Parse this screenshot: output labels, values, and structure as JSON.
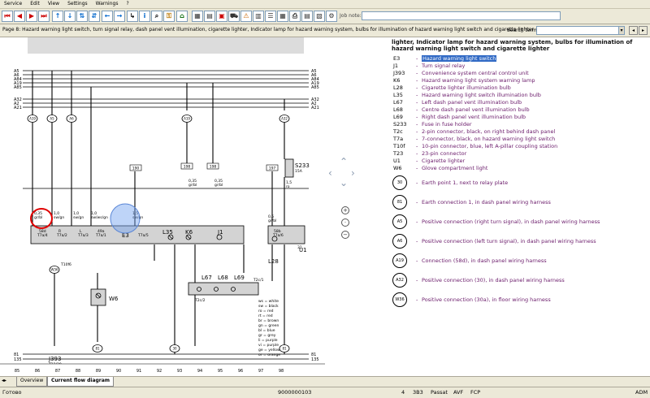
{
  "menu": [
    "Service",
    "Edit",
    "View",
    "Settings",
    "Warnings",
    "?"
  ],
  "toolbar": {
    "job_note_label": "Job note:"
  },
  "page": {
    "title": "Page 8: Hazard warning light switch, turn signal relay, dash panel vent illumination, cigarette lighter, Indicator lamp for hazard warning system, bulbs for illumination of hazard warning light switch and cigarette lighter"
  },
  "search": {
    "label": "Search term:",
    "value": ""
  },
  "legend": {
    "heading": "lighter, Indicator lamp for hazard warning system, bulbs for illumination of hazard warning light switch and cigarette lighter",
    "items": [
      {
        "code": "E3",
        "desc": "Hazard warning light switch",
        "selected": true
      },
      {
        "code": "J1",
        "desc": "Turn signal relay"
      },
      {
        "code": "J393",
        "desc": "Convenience system central control unit"
      },
      {
        "code": "K6",
        "desc": "Hazard warning light system warning lamp"
      },
      {
        "code": "L28",
        "desc": "Cigarette lighter illumination bulb"
      },
      {
        "code": "L35",
        "desc": "Hazard warning light switch illumination bulb"
      },
      {
        "code": "L67",
        "desc": "Left dash panel vent illumination bulb"
      },
      {
        "code": "L68",
        "desc": "Centre dash panel vent illumination bulb"
      },
      {
        "code": "L69",
        "desc": "Right dash panel vent illumination bulb"
      },
      {
        "code": "S233",
        "desc": "Fuse in fuse holder"
      },
      {
        "code": "T2c",
        "desc": "2-pin connector, black, on right behind dash panel"
      },
      {
        "code": "T7a",
        "desc": "7-connector, black, on hazard warning light switch"
      },
      {
        "code": "T10f",
        "desc": "10-pin connector, blue, left A-pillar coupling station"
      },
      {
        "code": "T23",
        "desc": "23-pin connector"
      },
      {
        "code": "U1",
        "desc": "Cigarette lighter"
      },
      {
        "code": "W6",
        "desc": "Glove compartment light"
      }
    ],
    "circles": [
      {
        "code": "30",
        "desc": "Earth point 1, next to relay plate"
      },
      {
        "code": "81",
        "desc": "Earth connection 1, in dash panel wiring harness"
      },
      {
        "code": "A5",
        "desc": "Positive connection (right turn signal), in dash panel wiring harness"
      },
      {
        "code": "A6",
        "desc": "Positive connection (left turn signal), in dash panel wiring harness"
      },
      {
        "code": "A19",
        "desc": "Connection (58d), in dash panel wiring harness"
      },
      {
        "code": "A32",
        "desc": "Positive connection (30), in dash panel wiring harness"
      },
      {
        "code": "W36",
        "desc": "Positive connection (30a), in floor wiring harness"
      }
    ]
  },
  "diagram": {
    "bus_labels_top": [
      "A5",
      "A6",
      "A84",
      "A19",
      "A85"
    ],
    "bus_labels_mid": [
      "A32",
      "A2",
      "A21"
    ],
    "bus_labels_bottom": [
      "81",
      "135"
    ],
    "ruler": [
      "85",
      "86",
      "87",
      "88",
      "89",
      "90",
      "91",
      "92",
      "93",
      "94",
      "95",
      "96",
      "97",
      "98"
    ],
    "wire_labels": [
      {
        "t": "0,35",
        "s": "gr/bl"
      },
      {
        "t": "1,0",
        "s": "sw/gn"
      },
      {
        "t": "1,0",
        "s": "sw/gn"
      },
      {
        "t": "1,0",
        "s": "sw/ws/gn"
      },
      {
        "t": "1,5",
        "s": "sw/gn"
      },
      {
        "t": "0,35",
        "s": "gr/bl"
      },
      {
        "t": "0,35",
        "s": "gr/bl"
      },
      {
        "t": "1,5",
        "s": "ro"
      },
      {
        "t": "0,5",
        "s": "gr/bl"
      }
    ],
    "terminals": [
      "58d",
      "T7a/4",
      "R",
      "T7a/2",
      "L",
      "T7a/3",
      "49a",
      "T7a/1",
      "E3",
      "T7a/5",
      "58b",
      "T7a/6",
      "31"
    ],
    "components": {
      "l35": "L35",
      "k6": "K6",
      "j1": "J1",
      "l28": "L28",
      "u1": "U1",
      "s233": "S233",
      "s233_rating": "15A",
      "w6": "W6",
      "j393": "J393",
      "j393_conn": "T23/20",
      "l67": "L67",
      "l68": "L68",
      "l69": "L69",
      "t10f": "T10f6",
      "t2c1": "T2c/1",
      "t2c2": "T2c/2"
    },
    "circle_labels": [
      "A19",
      "A5",
      "A6",
      "A19",
      "A32",
      "W36",
      "81",
      "30",
      "81"
    ],
    "node_numbers": [
      "190",
      "198",
      "198",
      "197"
    ],
    "colour_key": [
      "ws = white",
      "sw = black",
      "ro = red",
      "rt = red",
      "br = brown",
      "gn = green",
      "bl = blue",
      "gr = grey",
      "li = purple",
      "vi = purple",
      "ge = yellow",
      "or = orange"
    ]
  },
  "tabs": [
    "Overview",
    "Current flow diagram"
  ],
  "status": {
    "left": "Готово",
    "code": "9000000103",
    "n": "4",
    "model_code": "3B3",
    "model": "Passat",
    "engine": "AVF",
    "gearbox": "FCP",
    "right": "ADM"
  }
}
